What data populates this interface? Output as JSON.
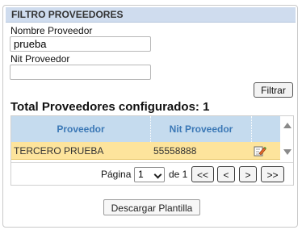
{
  "filter": {
    "title": "FILTRO PROVEEDORES",
    "name_label": "Nombre Proveedor",
    "name_value": "prueba",
    "nit_label": "Nit Proveedor",
    "nit_value": "",
    "filter_button": "Filtrar"
  },
  "summary": {
    "total_text": "Total Proveedores configurados: 1"
  },
  "grid": {
    "columns": [
      "Proveedor",
      "Nit Proveedor"
    ],
    "rows": [
      {
        "proveedor": "TERCERO PRUEBA",
        "nit": "55558888",
        "action_icon": "edit-icon"
      }
    ]
  },
  "pager": {
    "page_label": "Página",
    "current_page": "1",
    "of_label": "de 1",
    "first": "<<",
    "prev": "<",
    "next": ">",
    "last": ">>"
  },
  "actions": {
    "download_button": "Descargar Plantilla"
  },
  "colors": {
    "header_bg": "#cfdcee",
    "grid_header_bg": "#c5dbee",
    "grid_header_text": "#3b78b6",
    "selected_row_bg": "#fde49c"
  }
}
